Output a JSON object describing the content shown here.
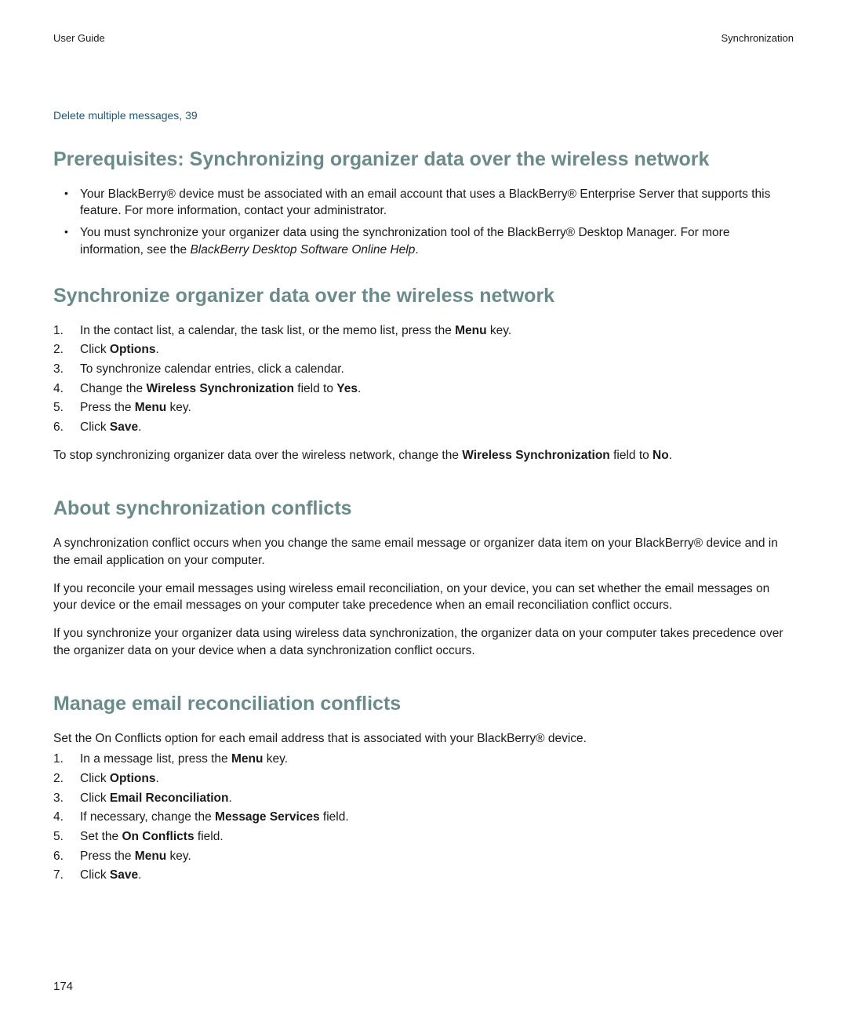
{
  "header": {
    "left": "User Guide",
    "right": "Synchronization"
  },
  "link": "Delete multiple messages, 39",
  "sections": {
    "prereq": {
      "title": "Prerequisites: Synchronizing organizer data over the wireless network",
      "bullets": [
        "Your BlackBerry® device must be associated with an email account that uses a BlackBerry® Enterprise Server that supports this feature. For more information, contact your administrator.",
        "You must synchronize your organizer data using the synchronization tool of the BlackBerry® Desktop Manager. For more information, see the "
      ],
      "bullet2_italic": "BlackBerry Desktop Software Online Help",
      "bullet2_end": "."
    },
    "sync": {
      "title": "Synchronize organizer data over the wireless network",
      "steps": {
        "s1_a": "In the contact list, a calendar, the task list, or the memo list, press the ",
        "s1_b": "Menu",
        "s1_c": " key.",
        "s2_a": "Click ",
        "s2_b": "Options",
        "s2_c": ".",
        "s3": "To synchronize calendar entries, click a calendar.",
        "s4_a": "Change the ",
        "s4_b": "Wireless Synchronization",
        "s4_c": " field to ",
        "s4_d": "Yes",
        "s4_e": ".",
        "s5_a": "Press the ",
        "s5_b": "Menu",
        "s5_c": " key.",
        "s6_a": "Click ",
        "s6_b": "Save",
        "s6_c": "."
      },
      "note_a": "To stop synchronizing organizer data over the wireless network, change the ",
      "note_b": "Wireless Synchronization",
      "note_c": " field to ",
      "note_d": "No",
      "note_e": "."
    },
    "about": {
      "title": "About synchronization conflicts",
      "p1": "A synchronization conflict occurs when you change the same email message or organizer data item on your BlackBerry® device and in the email application on your computer.",
      "p2": "If you reconcile your email messages using wireless email reconciliation, on your device, you can set whether the email messages on your device or the email messages on your computer take precedence when an email reconciliation conflict occurs.",
      "p3": "If you synchronize your organizer data using wireless data synchronization, the organizer data on your computer takes precedence over the organizer data on your device when a data synchronization conflict occurs."
    },
    "manage": {
      "title": "Manage email reconciliation conflicts",
      "intro": "Set the On Conflicts option for each email address that is associated with your BlackBerry® device.",
      "steps": {
        "s1_a": "In a message list, press the ",
        "s1_b": "Menu",
        "s1_c": " key.",
        "s2_a": "Click ",
        "s2_b": "Options",
        "s2_c": ".",
        "s3_a": "Click ",
        "s3_b": "Email Reconciliation",
        "s3_c": ".",
        "s4_a": "If necessary, change the ",
        "s4_b": "Message Services",
        "s4_c": " field.",
        "s5_a": "Set the ",
        "s5_b": "On Conflicts",
        "s5_c": " field.",
        "s6_a": "Press the ",
        "s6_b": "Menu",
        "s6_c": " key.",
        "s7_a": "Click ",
        "s7_b": "Save",
        "s7_c": "."
      }
    }
  },
  "pageNumber": "174"
}
